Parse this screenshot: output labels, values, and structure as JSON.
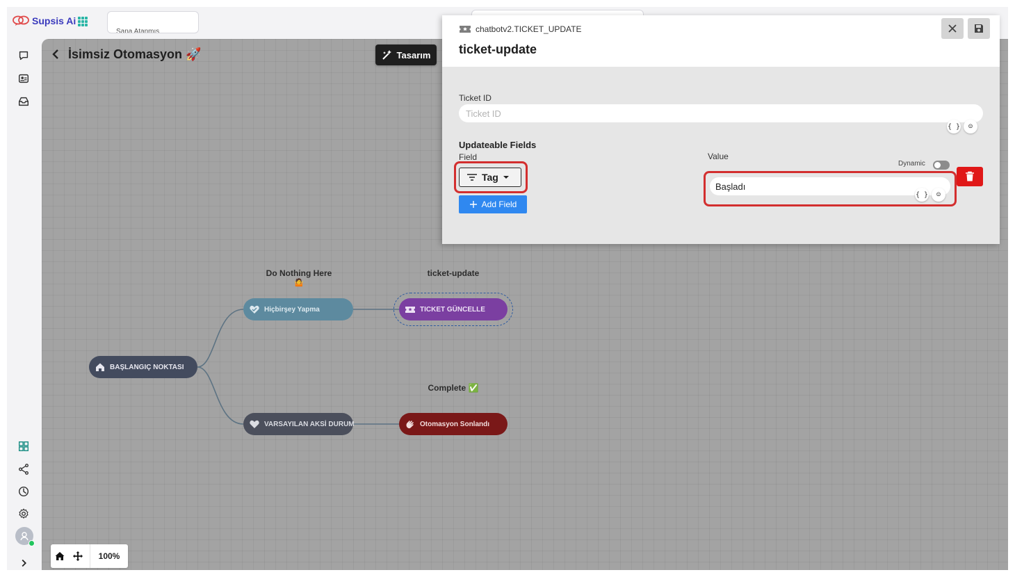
{
  "app": {
    "name": "Supsis Ai",
    "assignment_text": "Sana Atanmış",
    "brand_color": "#3b3bbd"
  },
  "canvas": {
    "title": "İsimsiz Otomasyon 🚀",
    "design_button": "Tasarım",
    "zoom_level": "100%",
    "nodes": {
      "start": "BAŞLANGIÇ NOKTASI",
      "nothing": "Hiçbirşey Yapma",
      "fail": "VARSAYILAN AKSİ DURUM",
      "ticket": "TICKET GÜNCELLE",
      "end": "Otomasyon Sonlandı"
    },
    "labels": {
      "nothing": "Do Nothing Here",
      "nothing_emoji": "🤷",
      "ticket": "ticket-update",
      "end": "Complete ✅"
    }
  },
  "panel": {
    "subtitle": "chatbotv2.TICKET_UPDATE",
    "title": "ticket-update",
    "ticket_id_label": "Ticket ID",
    "ticket_id_placeholder": "Ticket ID",
    "ticket_id_value": "",
    "updateable_title": "Updateable Fields",
    "field_label": "Field",
    "field_value": "Tag",
    "value_label": "Value",
    "dynamic_label": "Dynamic",
    "dynamic_enabled": false,
    "value_value": "Başladı",
    "add_field_label": "Add Field",
    "variable_icon_text": "{ }",
    "emoji_icon_text": "☺"
  },
  "icons": {
    "sidebar_top": [
      "chat-bubble-icon",
      "contact-card-icon",
      "inbox-icon"
    ],
    "sidebar_bottom": [
      "dashboard-grid-icon",
      "share-nodes-icon",
      "clock-icon",
      "gear-icon"
    ],
    "panel": [
      "ticket-icon",
      "close-icon",
      "save-icon",
      "trash-icon"
    ]
  }
}
